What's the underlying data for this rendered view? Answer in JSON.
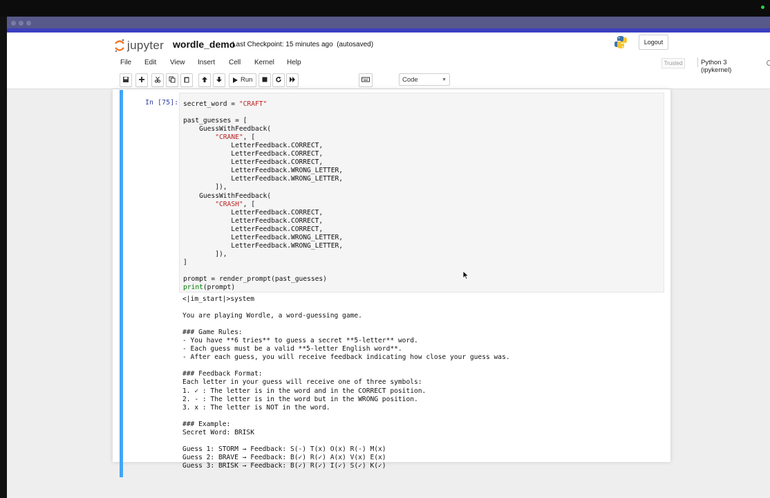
{
  "app": {
    "logo_text": "jupyter",
    "notebook_name": "wordle_demo",
    "checkpoint": "Last Checkpoint: 15 minutes ago",
    "autosave": "(autosaved)",
    "logout_label": "Logout"
  },
  "menu": {
    "items": [
      "File",
      "Edit",
      "View",
      "Insert",
      "Cell",
      "Kernel",
      "Help"
    ],
    "trusted": "Trusted",
    "kernel": "Python 3 (ipykernel)"
  },
  "toolbar": {
    "run_label": "Run",
    "cell_type": "Code",
    "icons": [
      "save-icon",
      "plus-icon",
      "cut-icon",
      "copy-icon",
      "paste-icon",
      "arrow-up-icon",
      "arrow-down-icon",
      "run-icon",
      "stop-icon",
      "restart-icon",
      "fast-forward-icon",
      "keyboard-icon"
    ]
  },
  "cell": {
    "prompt": "In [75]:",
    "code_lines": [
      [
        {
          "t": "secret_word = "
        },
        {
          "t": "\"CRAFT\"",
          "c": "s"
        }
      ],
      [],
      [
        {
          "t": "past_guesses = ["
        }
      ],
      [
        {
          "t": "    GuessWithFeedback("
        }
      ],
      [
        {
          "t": "        "
        },
        {
          "t": "\"CRANE\"",
          "c": "s"
        },
        {
          "t": ", ["
        }
      ],
      [
        {
          "t": "            LetterFeedback.CORRECT,"
        }
      ],
      [
        {
          "t": "            LetterFeedback.CORRECT,"
        }
      ],
      [
        {
          "t": "            LetterFeedback.CORRECT,"
        }
      ],
      [
        {
          "t": "            LetterFeedback.WRONG_LETTER,"
        }
      ],
      [
        {
          "t": "            LetterFeedback.WRONG_LETTER,"
        }
      ],
      [
        {
          "t": "        ]),"
        }
      ],
      [
        {
          "t": "    GuessWithFeedback("
        }
      ],
      [
        {
          "t": "        "
        },
        {
          "t": "\"CRASH\"",
          "c": "s"
        },
        {
          "t": ", ["
        }
      ],
      [
        {
          "t": "            LetterFeedback.CORRECT,"
        }
      ],
      [
        {
          "t": "            LetterFeedback.CORRECT,"
        }
      ],
      [
        {
          "t": "            LetterFeedback.CORRECT,"
        }
      ],
      [
        {
          "t": "            LetterFeedback.WRONG_LETTER,"
        }
      ],
      [
        {
          "t": "            LetterFeedback.WRONG_LETTER,"
        }
      ],
      [
        {
          "t": "        ]),"
        }
      ],
      [
        {
          "t": "]"
        }
      ],
      [],
      [
        {
          "t": "prompt = render_prompt(past_guesses)"
        }
      ],
      [
        {
          "t": "print",
          "c": "k"
        },
        {
          "t": "(prompt)"
        }
      ]
    ],
    "output_lines": [
      "<|im_start|>system",
      "",
      "You are playing Wordle, a word-guessing game.",
      "",
      "### Game Rules:",
      "- You have **6 tries** to guess a secret **5-letter** word.",
      "- Each guess must be a valid **5-letter English word**.",
      "- After each guess, you will receive feedback indicating how close your guess was.",
      "",
      "### Feedback Format:",
      "Each letter in your guess will receive one of three symbols:",
      "1. ✓ : The letter is in the word and in the CORRECT position.",
      "2. - : The letter is in the word but in the WRONG position.",
      "3. x : The letter is NOT in the word.",
      "",
      "### Example:",
      "Secret Word: BRISK",
      "",
      "Guess 1: STORM → Feedback: S(-) T(x) O(x) R(-) M(x)",
      "Guess 2: BRAVE → Feedback: B(✓) R(✓) A(x) V(x) E(x)",
      "Guess 3: BRISK → Feedback: B(✓) R(✓) I(✓) S(✓) K(✓)"
    ]
  }
}
